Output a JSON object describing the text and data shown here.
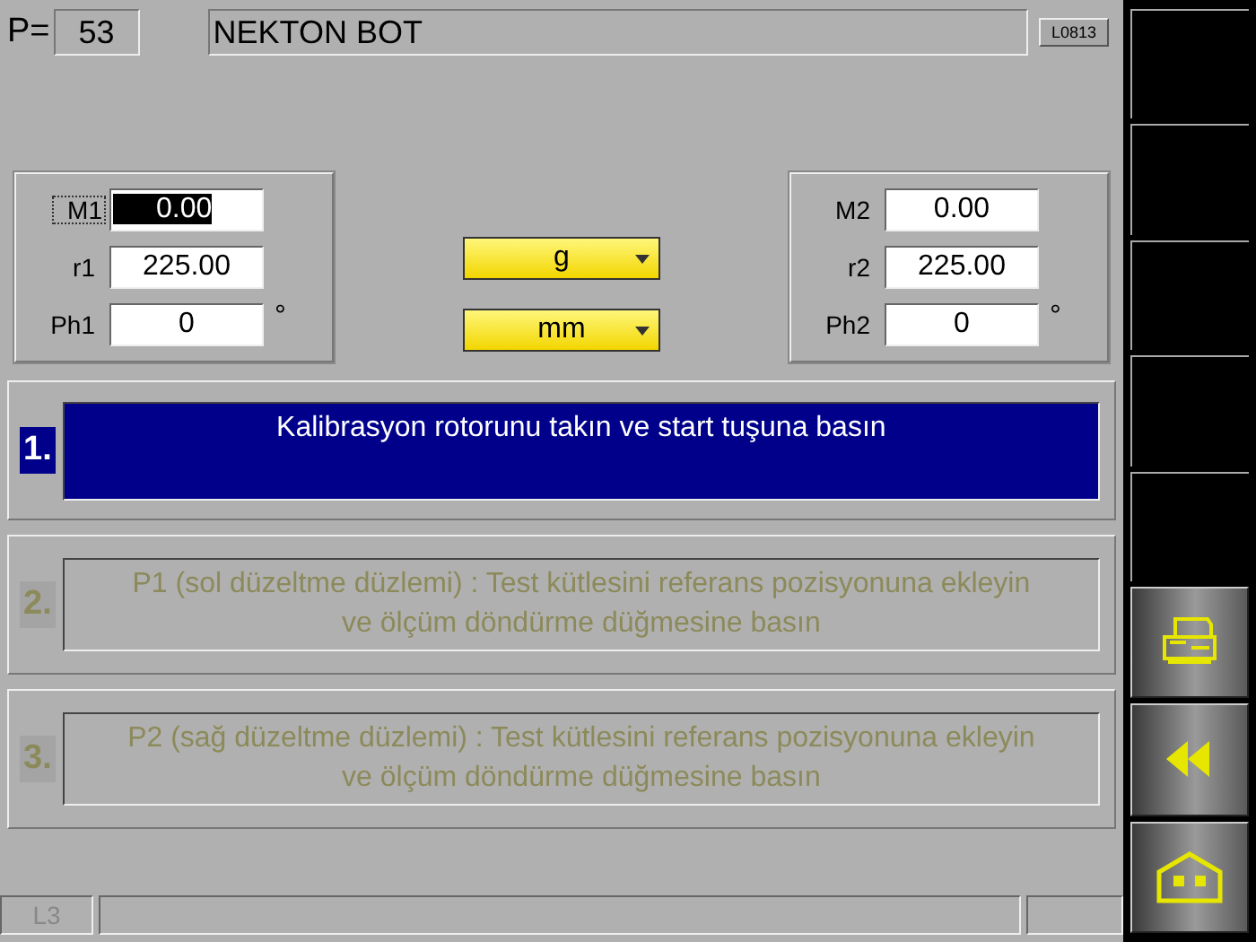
{
  "header": {
    "program_label": "P=",
    "program_number": "53",
    "title": "NEKTON BOT",
    "code": "L0813"
  },
  "left_group": [
    {
      "label": "M1",
      "value": "0.00",
      "focused": true
    },
    {
      "label": "r1",
      "value": "225.00",
      "focused": false
    },
    {
      "label": "Ph1",
      "value": "0",
      "focused": false,
      "unit": "°"
    }
  ],
  "units": [
    {
      "value": "g"
    },
    {
      "value": "mm"
    }
  ],
  "right_group": [
    {
      "label": "M2",
      "value": "0.00",
      "focused": false
    },
    {
      "label": "r2",
      "value": "225.00",
      "focused": false
    },
    {
      "label": "Ph2",
      "value": "0",
      "focused": false,
      "unit": "°"
    }
  ],
  "steps": [
    {
      "number": "1.",
      "text": "Kalibrasyon rotorunu takın ve start tuşuna basın",
      "active": true
    },
    {
      "number": "2.",
      "text": "P1 (sol düzeltme düzlemi) : Test kütlesini referans pozisyonuna ekleyin ve ölçüm döndürme düğmesine basın",
      "active": false
    },
    {
      "number": "3.",
      "text": "P2 (sağ düzeltme düzlemi) : Test kütlesini referans pozisyonuna ekleyin ve ölçüm döndürme düğmesine basın",
      "active": false
    }
  ],
  "status_bar": {
    "level_code": "L3"
  },
  "side_buttons": [
    {
      "kind": "blank"
    },
    {
      "kind": "blank"
    },
    {
      "kind": "blank"
    },
    {
      "kind": "blank"
    },
    {
      "kind": "blank"
    },
    {
      "kind": "printer"
    },
    {
      "kind": "rewind"
    },
    {
      "kind": "home"
    }
  ]
}
